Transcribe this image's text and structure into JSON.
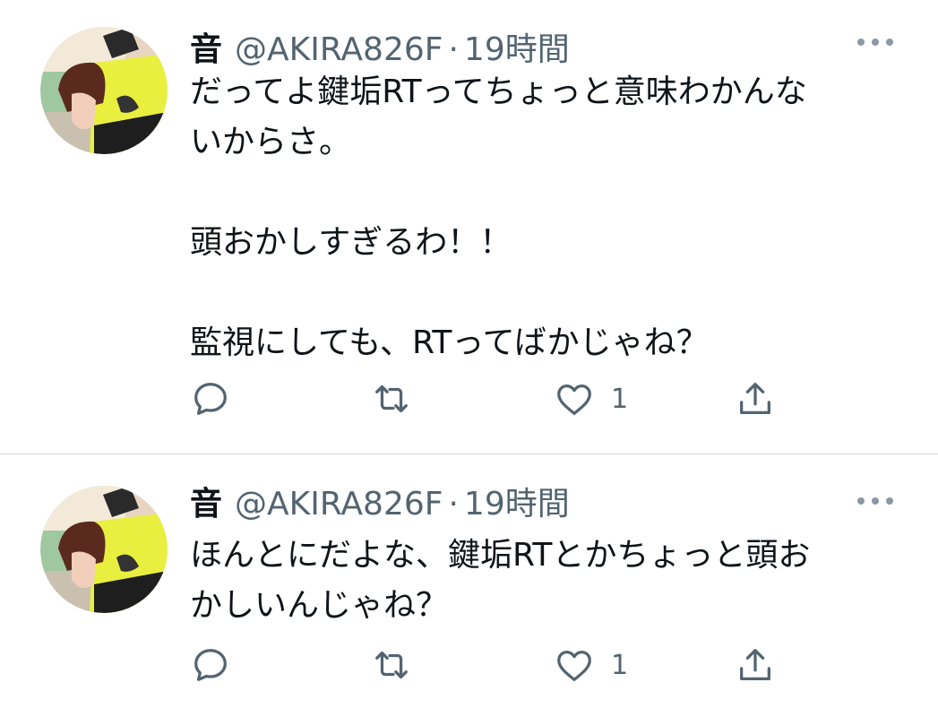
{
  "tweets": [
    {
      "author": {
        "name": "音",
        "handle": "@AKIRA826F",
        "separator": "·",
        "time": "19時間"
      },
      "text_lines": [
        "だってよ鍵垢RTってちょっと意味わかんな",
        "いからさ。",
        "",
        "頭おかしすぎるわ！！",
        "",
        "監視にしても、RTってばかじゃね？"
      ],
      "actions": {
        "reply_count": "",
        "retweet_count": "",
        "like_count": "1"
      }
    },
    {
      "author": {
        "name": "音",
        "handle": "@AKIRA826F",
        "separator": "·",
        "time": "19時間"
      },
      "text_lines": [
        "ほんとにだよな、鍵垢RTとかちょっと頭お",
        "かしいんじゃね？"
      ],
      "actions": {
        "reply_count": "",
        "retweet_count": "",
        "like_count": "1"
      }
    }
  ],
  "icons": {
    "more": "more-horizontal-icon",
    "reply": "reply-icon",
    "retweet": "retweet-icon",
    "like": "heart-icon",
    "share": "share-icon"
  },
  "colors": {
    "text_primary": "#0f1419",
    "text_secondary": "#536471",
    "divider": "#cfd9de",
    "icon": "#536471"
  }
}
